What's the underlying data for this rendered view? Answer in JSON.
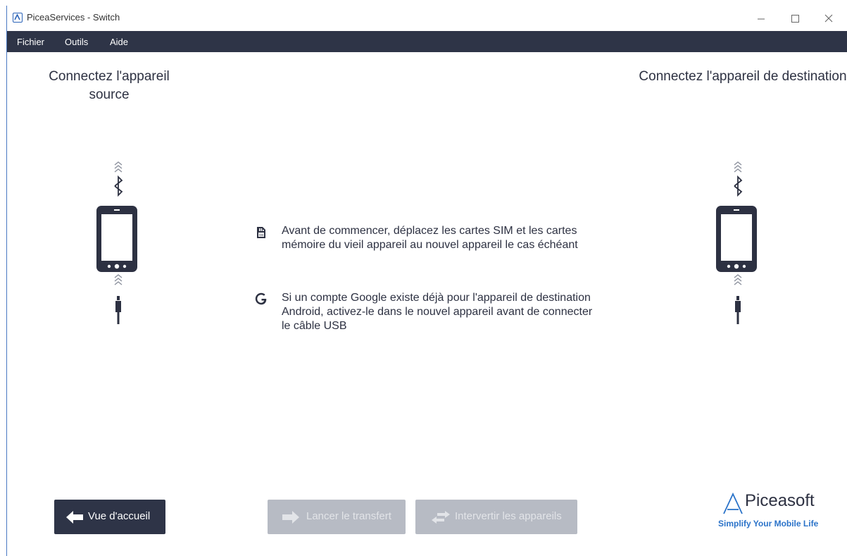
{
  "window": {
    "title": "PiceaServices - Switch"
  },
  "menu": {
    "items": [
      "Fichier",
      "Outils",
      "Aide"
    ]
  },
  "source": {
    "heading": "Connectez l'appareil source"
  },
  "destination": {
    "heading": "Connectez l'appareil de destination"
  },
  "info": [
    {
      "icon": "sd-card-icon",
      "text": "Avant de commencer, déplacez les cartes SIM et les cartes mémoire du vieil appareil au nouvel appareil le cas échéant"
    },
    {
      "icon": "google-icon",
      "text": "Si un compte Google existe déjà pour l'appareil de destination Android, activez-le dans le nouvel appareil avant de connecter le câble USB"
    }
  ],
  "buttons": {
    "home": "Vue d'accueil",
    "start": "Lancer le transfert",
    "swap": "Intervertir les appareils"
  },
  "brand": {
    "name": "Piceasoft",
    "tagline": "Simplify Your Mobile Life"
  },
  "colors": {
    "primary": "#2e3447",
    "disabled": "#b7bbc4",
    "accent": "#2b73c9"
  }
}
